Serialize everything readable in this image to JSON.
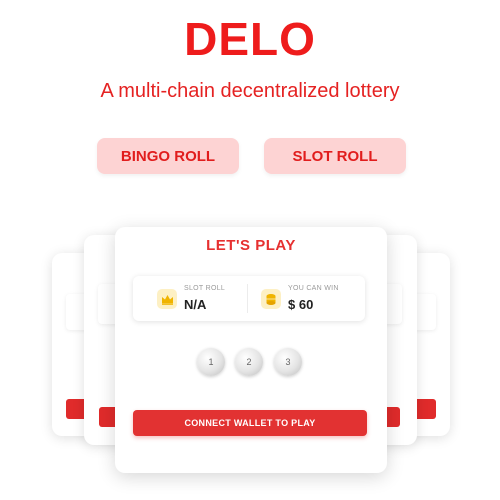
{
  "header": {
    "title": "DELO",
    "subtitle": "A multi-chain decentralized lottery"
  },
  "modes": {
    "bingo_label": "BINGO ROLL",
    "slot_label": "SLOT ROLL"
  },
  "card": {
    "title": "LET'S PLAY",
    "slot_roll_label": "SLOT ROLL",
    "slot_roll_value": "N/A",
    "win_label": "YOU CAN WIN",
    "win_value": "$ 60",
    "balls": [
      "1",
      "2",
      "3"
    ],
    "connect_label": "CONNECT WALLET TO PLAY"
  },
  "icons": {
    "slot_roll": "crown-icon",
    "win": "coin-stack-icon"
  },
  "colors": {
    "brand_red": "#ee1c1c",
    "button_bg": "#fdd3d3",
    "cta_red": "#e23232"
  }
}
